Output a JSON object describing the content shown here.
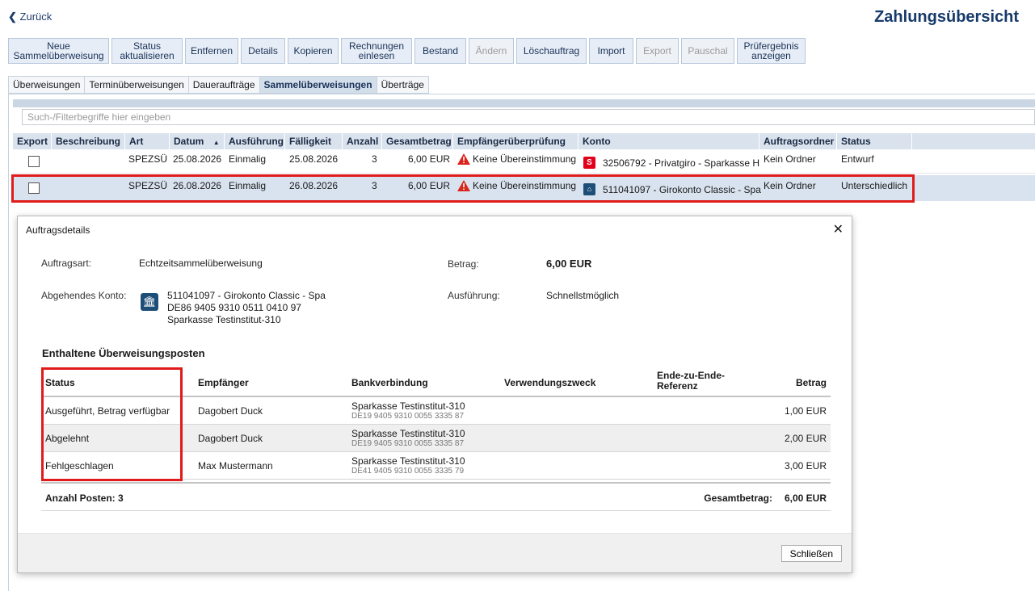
{
  "header": {
    "back_label": "Zurück",
    "title": "Zahlungsübersicht"
  },
  "toolbar": [
    {
      "label": "Neue Sammelüberweisung",
      "enabled": true
    },
    {
      "label": "Status aktualisieren",
      "enabled": true
    },
    {
      "label": "Entfernen",
      "enabled": true
    },
    {
      "label": "Details",
      "enabled": true
    },
    {
      "label": "Kopieren",
      "enabled": true
    },
    {
      "label": "Rechnungen einlesen",
      "enabled": true
    },
    {
      "label": "Bestand",
      "enabled": true
    },
    {
      "label": "Ändern",
      "enabled": false
    },
    {
      "label": "Löschauftrag",
      "enabled": true
    },
    {
      "label": "Import",
      "enabled": true
    },
    {
      "label": "Export",
      "enabled": false
    },
    {
      "label": "Pauschal",
      "enabled": false
    },
    {
      "label": "Prüfergebnis anzeigen",
      "enabled": true
    }
  ],
  "tabs": [
    {
      "label": "Überweisungen",
      "active": false
    },
    {
      "label": "Terminüberweisungen",
      "active": false
    },
    {
      "label": "Daueraufträge",
      "active": false
    },
    {
      "label": "Sammelüberweisungen",
      "active": true
    },
    {
      "label": "Überträge",
      "active": false
    }
  ],
  "filter": {
    "placeholder": "Such-/Filterbegriffe hier eingeben"
  },
  "grid": {
    "columns": [
      "Export",
      "Beschreibung",
      "Art",
      "Datum",
      "Ausführung",
      "Fälligkeit",
      "Anzahl",
      "Gesamtbetrag",
      "Empfängerüberprüfung",
      "Konto",
      "Auftragsordner",
      "Status"
    ],
    "sort_indicator": "▲",
    "rows": [
      {
        "beschreibung": "",
        "art": "SPEZSÜ",
        "datum": "25.08.2026",
        "ausfuehrung": "Einmalig",
        "faelligkeit": "25.08.2026",
        "anzahl": "3",
        "gesamtbetrag": "6,00 EUR",
        "empfaenger": "Keine Übereinstimmung",
        "konto": "32506792 - Privatgiro - Sparkasse H",
        "ordner": "Kein Ordner",
        "status": "Entwurf"
      },
      {
        "beschreibung": "",
        "art": "SPEZSÜ",
        "datum": "26.08.2026",
        "ausfuehrung": "Einmalig",
        "faelligkeit": "26.08.2026",
        "anzahl": "3",
        "gesamtbetrag": "6,00 EUR",
        "empfaenger": "Keine Übereinstimmung",
        "konto": "511041097 - Girokonto Classic - Spa",
        "ordner": "Kein Ordner",
        "status": "Unterschiedlich"
      }
    ]
  },
  "modal": {
    "title": "Auftragsdetails",
    "auftragsart_label": "Auftragsart:",
    "auftragsart": "Echtzeitsammelüberweisung",
    "betrag_label": "Betrag:",
    "betrag": "6,00 EUR",
    "konto_label": "Abgehendes Konto:",
    "konto_line1": "511041097 - Girokonto Classic - Spa",
    "konto_line2": "DE86 9405 9310 0511 0410 97",
    "konto_line3": "Sparkasse Testinstitut-310",
    "ausfuehrung_label": "Ausführung:",
    "ausfuehrung": "Schnellstmöglich",
    "section_title": "Enthaltene Überweisungsposten",
    "columns": {
      "status": "Status",
      "empfaenger": "Empfänger",
      "bank": "Bankverbindung",
      "zweck": "Verwendungszweck",
      "ref1": "Ende-zu-Ende-",
      "ref2": "Referenz",
      "betrag": "Betrag"
    },
    "posten": [
      {
        "status": "Ausgeführt, Betrag verfügbar",
        "empfaenger": "Dagobert Duck",
        "bank": "Sparkasse Testinstitut-310",
        "iban": "DE19 9405 9310 0055 3335 87",
        "betrag": "1,00 EUR"
      },
      {
        "status": "Abgelehnt",
        "empfaenger": "Dagobert Duck",
        "bank": "Sparkasse Testinstitut-310",
        "iban": "DE19 9405 9310 0055 3335 87",
        "betrag": "2,00 EUR"
      },
      {
        "status": "Fehlgeschlagen",
        "empfaenger": "Max Mustermann",
        "bank": "Sparkasse Testinstitut-310",
        "iban": "DE41 9405 9310 0055 3335 79",
        "betrag": "3,00 EUR"
      }
    ],
    "anzahl_label": "Anzahl Posten: 3",
    "gesamt_label": "Gesamtbetrag:",
    "gesamt": "6,00 EUR",
    "close_label": "Schließen"
  },
  "colors": {
    "highlight": "#e01b1b",
    "accent": "#173a6b",
    "selected_row": "#d9e3ef",
    "warning": "#d9261c",
    "sparkasse": "#e2001a",
    "bank_icon": "#1d4e78"
  }
}
